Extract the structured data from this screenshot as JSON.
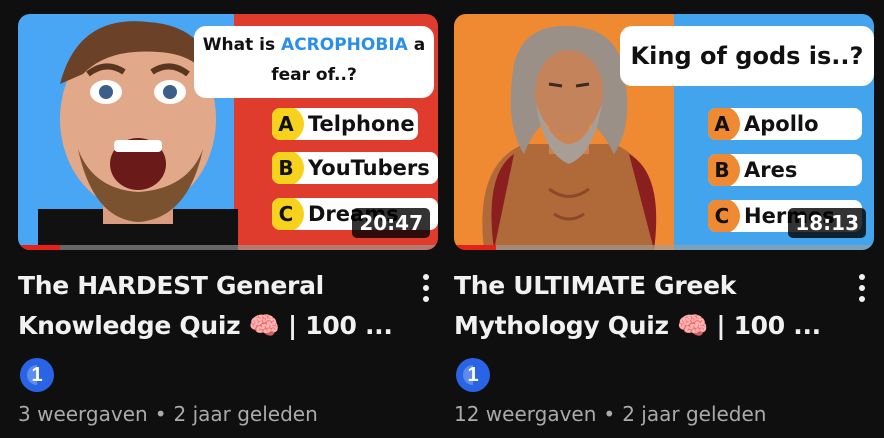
{
  "videos": [
    {
      "duration": "20:47",
      "progress": 0.1,
      "question_pre": "What is ",
      "question_accent": "ACROPHOBIA",
      "question_post": " a fear of..?",
      "answers": [
        {
          "letter": "A",
          "text": "Telphone"
        },
        {
          "letter": "B",
          "text": "YouTubers"
        },
        {
          "letter": "C",
          "text": "Dreams"
        }
      ],
      "title_line1": "The HARDEST General",
      "title_line2": "Knowledge Quiz 🧠 | 100 ...",
      "channel_avatar": "1",
      "views": "3 weergaven",
      "age": "2 jaar geleden"
    },
    {
      "duration": "18:13",
      "progress": 0.1,
      "question": "King of gods is..?",
      "answers": [
        {
          "letter": "A",
          "text": "Apollo"
        },
        {
          "letter": "B",
          "text": "Ares"
        },
        {
          "letter": "C",
          "text": "Hermes"
        }
      ],
      "title_line1": "The ULTIMATE Greek",
      "title_line2": "Mythology Quiz 🧠 | 100 ...",
      "channel_avatar": "1",
      "views": "12 weergaven",
      "age": "2 jaar geleden"
    }
  ],
  "separator": "•",
  "icons": {
    "menu": "vertical-dots-icon",
    "avatar": "channel-avatar-icon"
  },
  "colors": {
    "progress": "#e62117",
    "background": "#0f0f0f",
    "meta_text": "#aaaaaa"
  }
}
